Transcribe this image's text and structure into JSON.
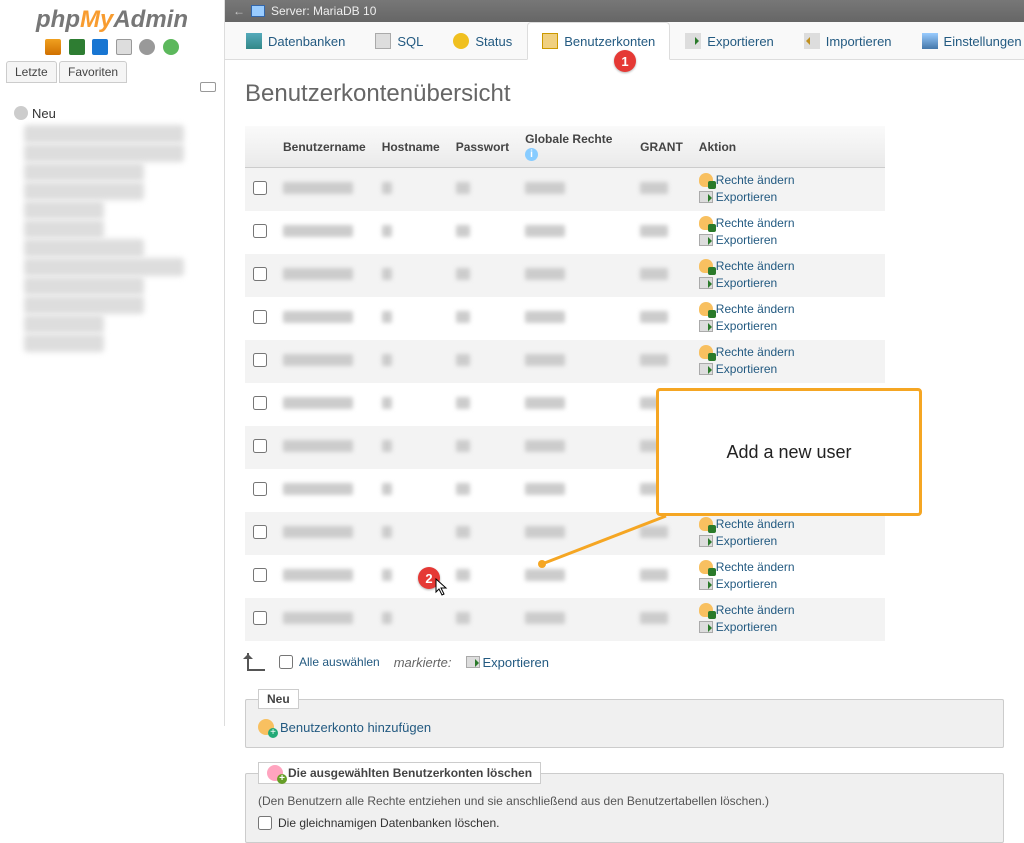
{
  "sidebar": {
    "tab_recent": "Letzte",
    "tab_fav": "Favoriten",
    "new_label": "Neu"
  },
  "server": {
    "label": "Server: MariaDB 10"
  },
  "tabs": {
    "databases": "Datenbanken",
    "sql": "SQL",
    "status": "Status",
    "users": "Benutzerkonten",
    "export": "Exportieren",
    "import": "Importieren",
    "settings": "Einstellungen"
  },
  "badges": {
    "b1": "1",
    "b2": "2"
  },
  "page": {
    "title": "Benutzerkontenübersicht"
  },
  "cols": {
    "user": "Benutzername",
    "host": "Hostname",
    "pass": "Passwort",
    "global": "Globale Rechte",
    "grant": "GRANT",
    "action": "Aktion"
  },
  "actions": {
    "edit": "Rechte ändern",
    "export": "Exportieren"
  },
  "footer": {
    "select_all": "Alle auswählen",
    "marked": "markierte:",
    "export": "Exportieren"
  },
  "newbox": {
    "legend": "Neu",
    "add_user": "Benutzerkonto hinzufügen"
  },
  "delbox": {
    "legend": "Die ausgewählten Benutzerkonten löschen",
    "note": "(Den Benutzern alle Rechte entziehen und sie anschließend aus den Benutzertabellen löschen.)",
    "drop_db": "Die gleichnamigen Datenbanken löschen."
  },
  "callout": {
    "text": "Add a new user"
  }
}
